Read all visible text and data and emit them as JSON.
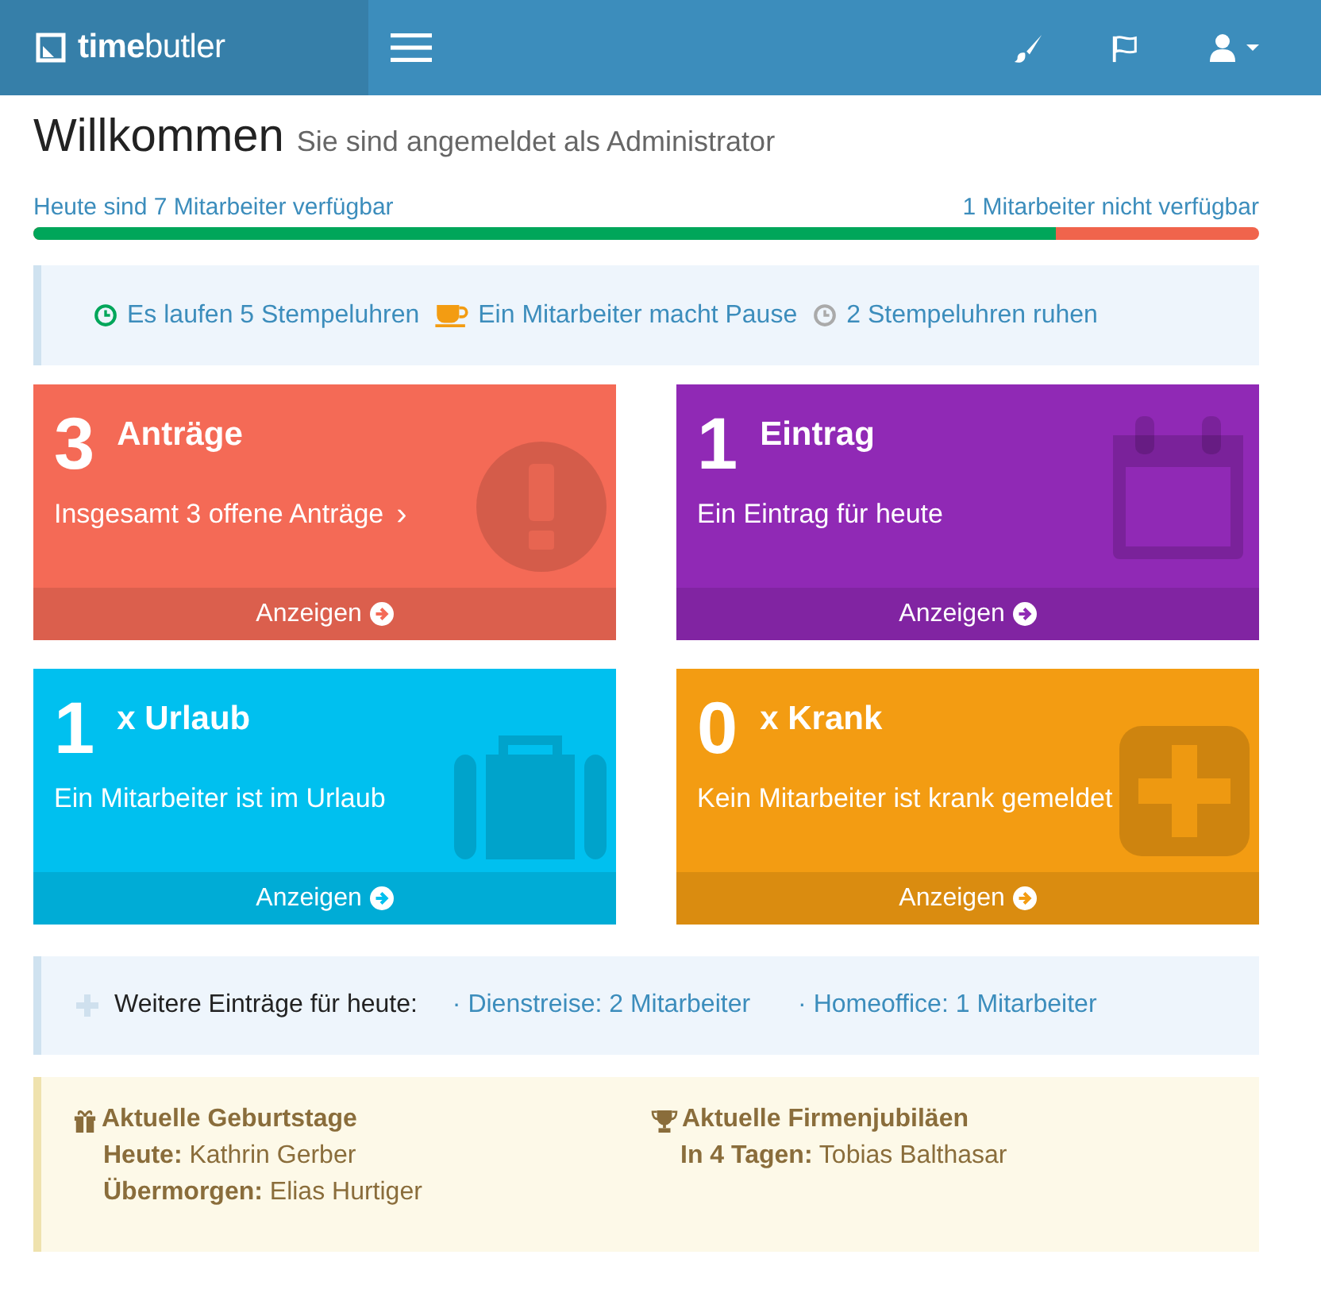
{
  "header": {
    "logo": "**time**butler"
  },
  "welcome": {
    "title": "Willkommen",
    "subtitle": "Sie sind angemeldet als Administrator"
  },
  "availability": {
    "available": "Heute sind 7 Mitarbeiter verfügbar",
    "unavailable": "1 Mitarbeiter nicht verfügbar",
    "level": 0.834
  },
  "clocks": [
    {
      "kind": "running",
      "text": "Es laufen 5 Stempeluhren"
    },
    {
      "kind": "pause",
      "text": "Ein Mitarbeiter macht Pause"
    },
    {
      "kind": "idle",
      "text": "2 Stempeluhren ruhen"
    }
  ],
  "cards": [
    {
      "kind": "alert",
      "color": "#f46a56",
      "count": "3",
      "title": "Anträge",
      "text": "Insgesamt 3 offene Anträge",
      "chevron": "›",
      "action": "Anzeigen"
    },
    {
      "kind": "calendar",
      "color": "#9029b5",
      "count": "1",
      "title": "Eintrag",
      "text": "Ein Eintrag für heute",
      "action": "Anzeigen"
    },
    {
      "kind": "suitcase",
      "color": "#00c0ef",
      "count": "1",
      "title": "x Urlaub",
      "text": "Ein Mitarbeiter ist im Urlaub",
      "action": "Anzeigen"
    },
    {
      "kind": "plus",
      "color": "#f39c12",
      "count": "0",
      "title": "x Krank",
      "text": "Kein Mitarbeiter ist krank gemeldet",
      "action": "Anzeigen"
    }
  ],
  "more": {
    "label": "Weitere Einträge für heute:",
    "links": [
      "· Dienstreise: 2 Mitarbeiter",
      "· Homeoffice: 1 Mitarbeiter"
    ]
  },
  "events": [
    {
      "kind": "gift",
      "title": "Aktuelle Geburtstage",
      "lines": [
        "**Heute:** Kathrin Gerber",
        "**Übermorgen:** Elias Hurtiger"
      ]
    },
    {
      "kind": "trophy",
      "title": "Aktuelle Firmenjubiläen",
      "lines": [
        "**In 4 Tagen:** Tobias Balthasar"
      ]
    }
  ]
}
